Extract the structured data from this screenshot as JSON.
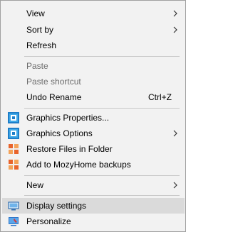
{
  "menu": {
    "items": [
      {
        "label": "View",
        "submenu": true
      },
      {
        "label": "Sort by",
        "submenu": true
      },
      {
        "label": "Refresh"
      },
      {
        "label": "Paste",
        "disabled": true
      },
      {
        "label": "Paste shortcut",
        "disabled": true
      },
      {
        "label": "Undo Rename",
        "shortcut": "Ctrl+Z"
      },
      {
        "label": "Graphics Properties...",
        "icon": "intel-graphics-icon"
      },
      {
        "label": "Graphics Options",
        "icon": "intel-graphics-icon",
        "submenu": true
      },
      {
        "label": "Restore Files in Folder",
        "icon": "mozy-icon"
      },
      {
        "label": "Add to MozyHome backups",
        "icon": "mozy-icon"
      },
      {
        "label": "New",
        "submenu": true
      },
      {
        "label": "Display settings",
        "icon": "display-icon",
        "highlighted": true
      },
      {
        "label": "Personalize",
        "icon": "personalize-icon"
      }
    ]
  },
  "colors": {
    "menu_bg": "#f2f2f2",
    "highlight": "#dadada",
    "border": "#a0a0a0",
    "disabled_text": "#6d6d6d",
    "separator": "#c8c8c8"
  }
}
